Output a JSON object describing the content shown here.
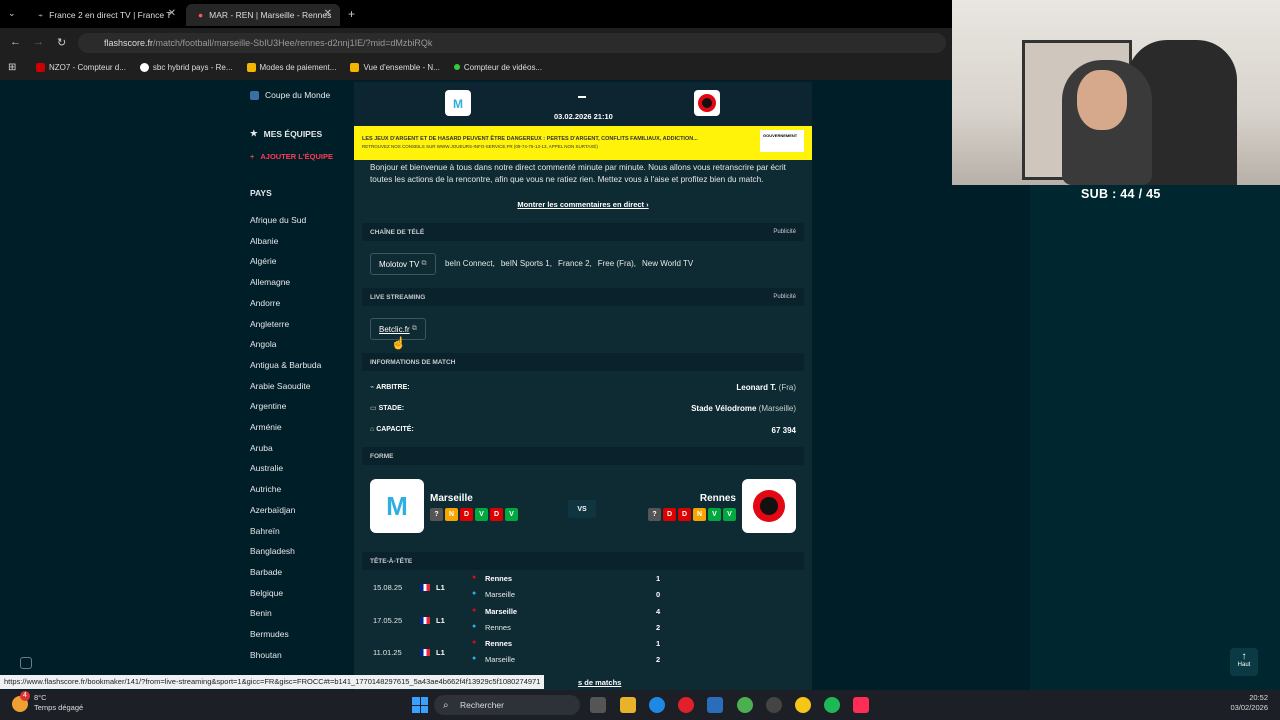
{
  "browser": {
    "tabs": [
      {
        "label": "France 2 en direct TV | France T"
      },
      {
        "label": "MAR - REN | Marseille - Rennes"
      }
    ],
    "url_host": "flashscore.fr",
    "url_path": "/match/football/marseille-SbIU3Hee/rennes-d2nnj1IE/?mid=dMzbiRQk",
    "bookmarks": [
      "NZO7 - Compteur d...",
      "sbc hybrid pays - Re...",
      "Modes de paiement...",
      "Vue d'ensemble - N...",
      "Compteur de vidéos..."
    ]
  },
  "stream": {
    "subs": "SUB : 44 / 45"
  },
  "sidebar": {
    "top_item": "Coupe du Monde",
    "my_teams": "MES ÉQUIPES",
    "add_team": "AJOUTER L'ÉQUIPE",
    "countries_title": "PAYS",
    "countries": [
      "Afrique du Sud",
      "Albanie",
      "Algérie",
      "Allemagne",
      "Andorre",
      "Angleterre",
      "Angola",
      "Antigua & Barbuda",
      "Arabie Saoudite",
      "Argentine",
      "Arménie",
      "Aruba",
      "Australie",
      "Autriche",
      "Azerbaïdjan",
      "Bahreïn",
      "Bangladesh",
      "Barbade",
      "Belgique",
      "Benin",
      "Bermudes",
      "Bhoutan"
    ]
  },
  "match": {
    "datetime": "03.02.2026 21:10",
    "warning_line1": "LES JEUX D'ARGENT ET DE HASARD PEUVENT ÊTRE DANGEREUX : PERTES D'ARGENT, CONFLITS FAMILIAUX, ADDICTION...",
    "warning_line2": "RETROUVEZ NOS CONSEILS SUR WWW.JOUEURS-INFO-SERVICE.FR (09-74-75-13-13, APPEL NON SURTAXÉ)",
    "gov_label": "GOUVERNEMENT",
    "intro": "Bonjour et bienvenue à tous dans notre direct commenté minute par minute. Nous allons vous retranscrire par écrit toutes les actions de la rencontre, afin que vous ne ratiez rien. Mettez vous à l'aise et profitez bien du match.",
    "show_comments": "Montrer les commentaires en direct",
    "tv_title": "CHAÎNE DE TÉLÉ",
    "ad_label": "Publicité",
    "tv_button": "Molotov TV",
    "channels": [
      "beIn Connect,",
      "beIN Sports 1,",
      "France 2,",
      "Free (Fra),",
      "New World TV"
    ],
    "streaming_title": "LIVE STREAMING",
    "streaming_button": "Betclic.fr",
    "info_title": "INFORMATIONS DE MATCH",
    "referee_label": "ARBITRE:",
    "referee_name": "Leonard T.",
    "referee_country": "(Fra)",
    "stadium_label": "STADE:",
    "stadium_name": "Stade Vélodrome",
    "stadium_city": "(Marseille)",
    "capacity_label": "CAPACITÉ:",
    "capacity": "67 394",
    "form_title": "FORME",
    "home_team": "Marseille",
    "away_team": "Rennes",
    "vs": "VS",
    "home_form": [
      "?",
      "N",
      "D",
      "V",
      "D",
      "V"
    ],
    "away_form": [
      "?",
      "D",
      "D",
      "N",
      "V",
      "V"
    ],
    "h2h_title": "TÊTE-À-TÊTE",
    "h2h": [
      {
        "date": "15.08.25",
        "comp": "L1",
        "team1": "Rennes",
        "score1": "1",
        "team2": "Marseille",
        "score2": "0"
      },
      {
        "date": "17.05.25",
        "comp": "L1",
        "team1": "Marseille",
        "score1": "4",
        "team2": "Rennes",
        "score2": "2"
      },
      {
        "date": "11.01.25",
        "comp": "L1",
        "team1": "Rennes",
        "score1": "1",
        "team2": "Marseille",
        "score2": "2"
      }
    ],
    "more_matches": "s de matchs"
  },
  "status_url": "https://www.flashscore.fr/bookmaker/141/?from=live-streaming&sport=1&gicc=FR&gisc=FROCC#t=b141_1770148297615_5a43ae4b662f4f13929c5f1080274971",
  "haut_label": "Haut",
  "taskbar": {
    "temp": "8°C",
    "weather": "Temps dégagé",
    "badge": "4",
    "search": "Rechercher",
    "time": "20:52",
    "date": "03/02/2026"
  }
}
